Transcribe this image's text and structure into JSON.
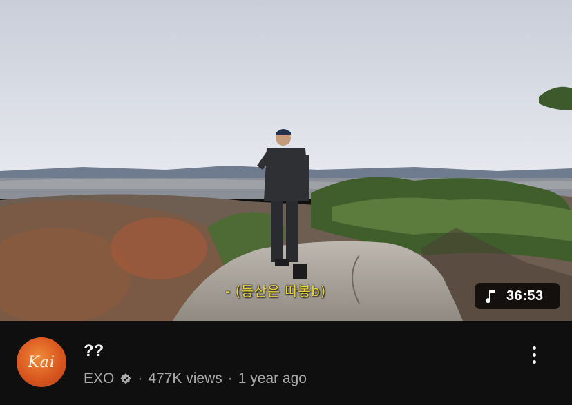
{
  "video": {
    "subtitle": "- (등산은 따봉b)",
    "duration": "36:53",
    "duration_icon": "music-note-icon"
  },
  "info": {
    "avatar_text": "Kai",
    "title": "??",
    "channel": "EXO",
    "verified_icon": "verified-badge-icon",
    "sep1": "·",
    "views": "477K views",
    "sep2": "·",
    "age": "1 year ago",
    "menu_icon": "more-vertical-icon"
  },
  "colors": {
    "background": "#0f0f0f",
    "subtitle": "#e8d23a",
    "meta": "#aaaaaa",
    "title": "#f1f1f1"
  }
}
